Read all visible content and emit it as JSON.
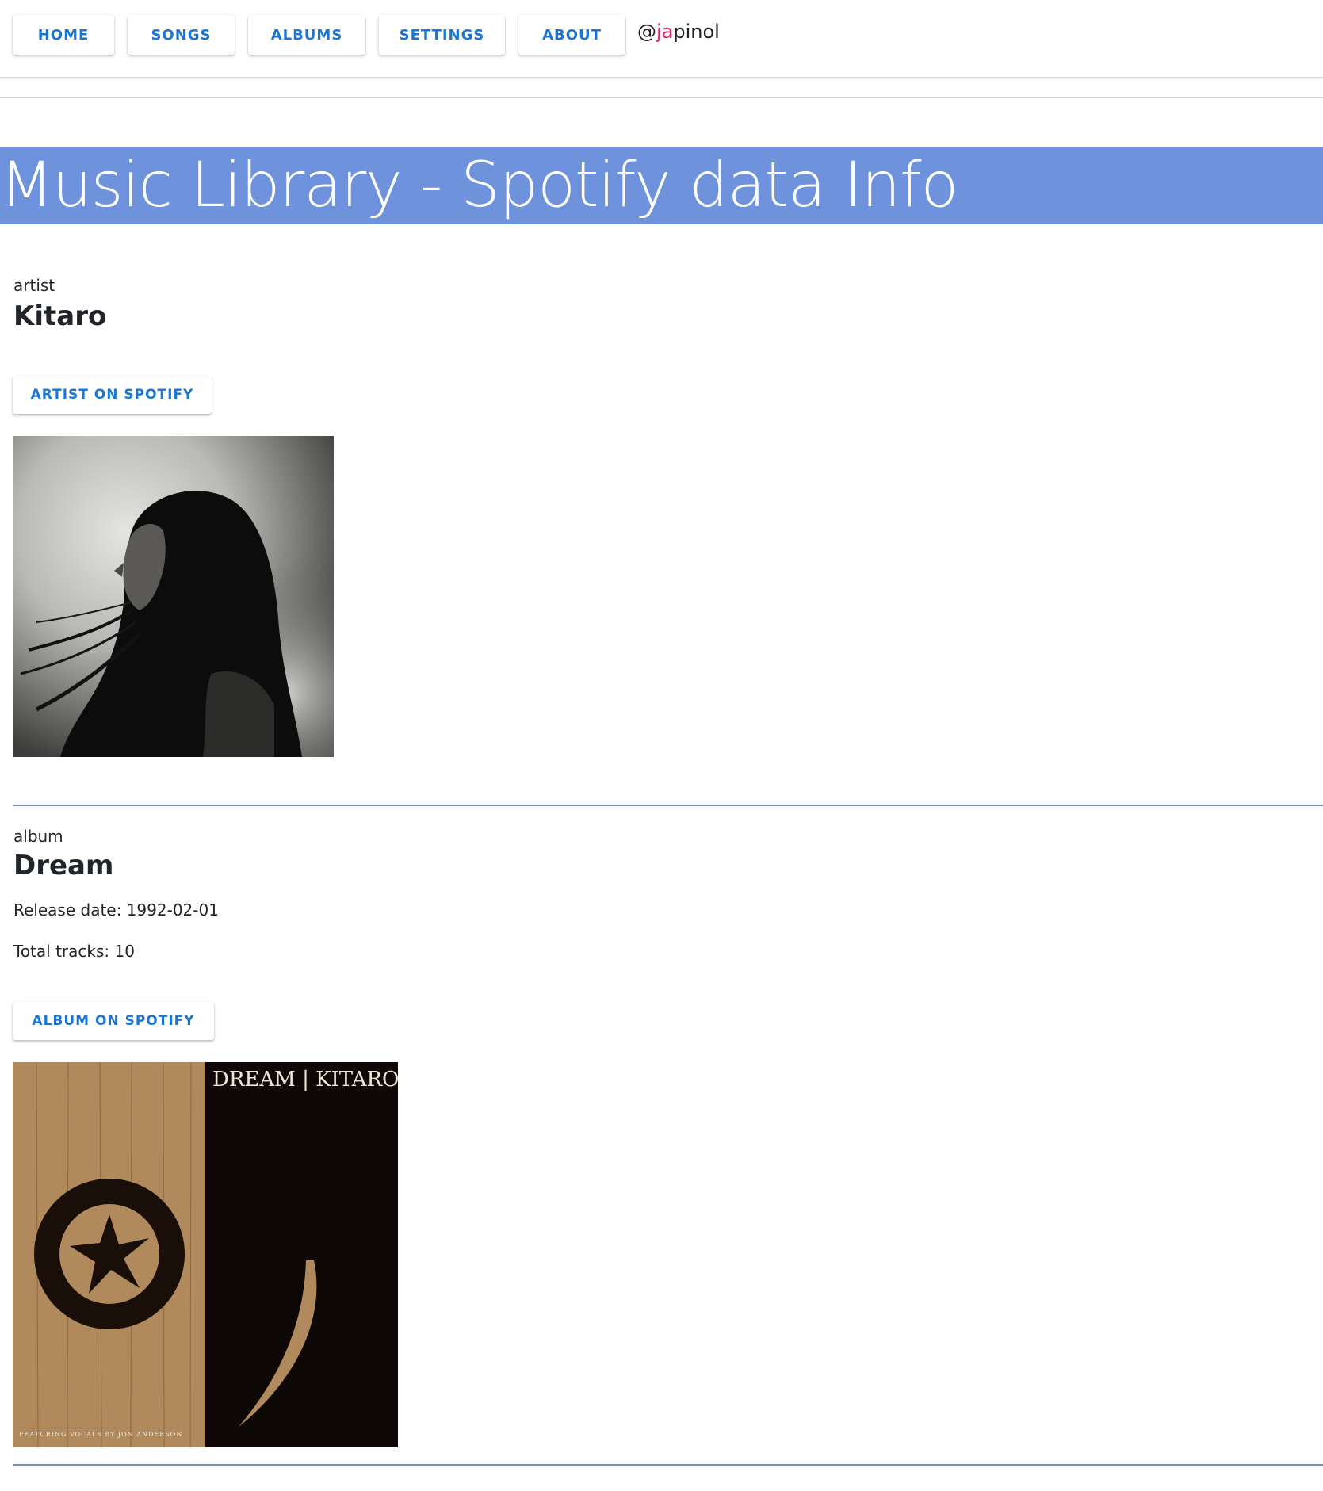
{
  "nav": {
    "buttons": [
      "HOME",
      "SONGS",
      "ALBUMS",
      "SETTINGS",
      "ABOUT"
    ],
    "handle_prefix": "@",
    "handle_highlight": "ja",
    "handle_rest": "pinol",
    "accent_color": "#1976d2",
    "highlight_color": "#e91e63"
  },
  "banner": {
    "title": "Music Library - Spotify data Info",
    "background_color": "#6f92dc"
  },
  "artist": {
    "label": "artist",
    "name": "Kitaro",
    "spotify_button": "ARTIST ON SPOTIFY"
  },
  "album": {
    "label": "album",
    "name": "Dream",
    "release_label": "Release date: ",
    "release_date": "1992-02-01",
    "tracks_label": "Total tracks: ",
    "total_tracks": "10",
    "spotify_button": "ALBUM ON SPOTIFY",
    "cover_title": "DREAM | KITARO",
    "cover_credit": "FEATURING VOCALS BY JON ANDERSON"
  }
}
